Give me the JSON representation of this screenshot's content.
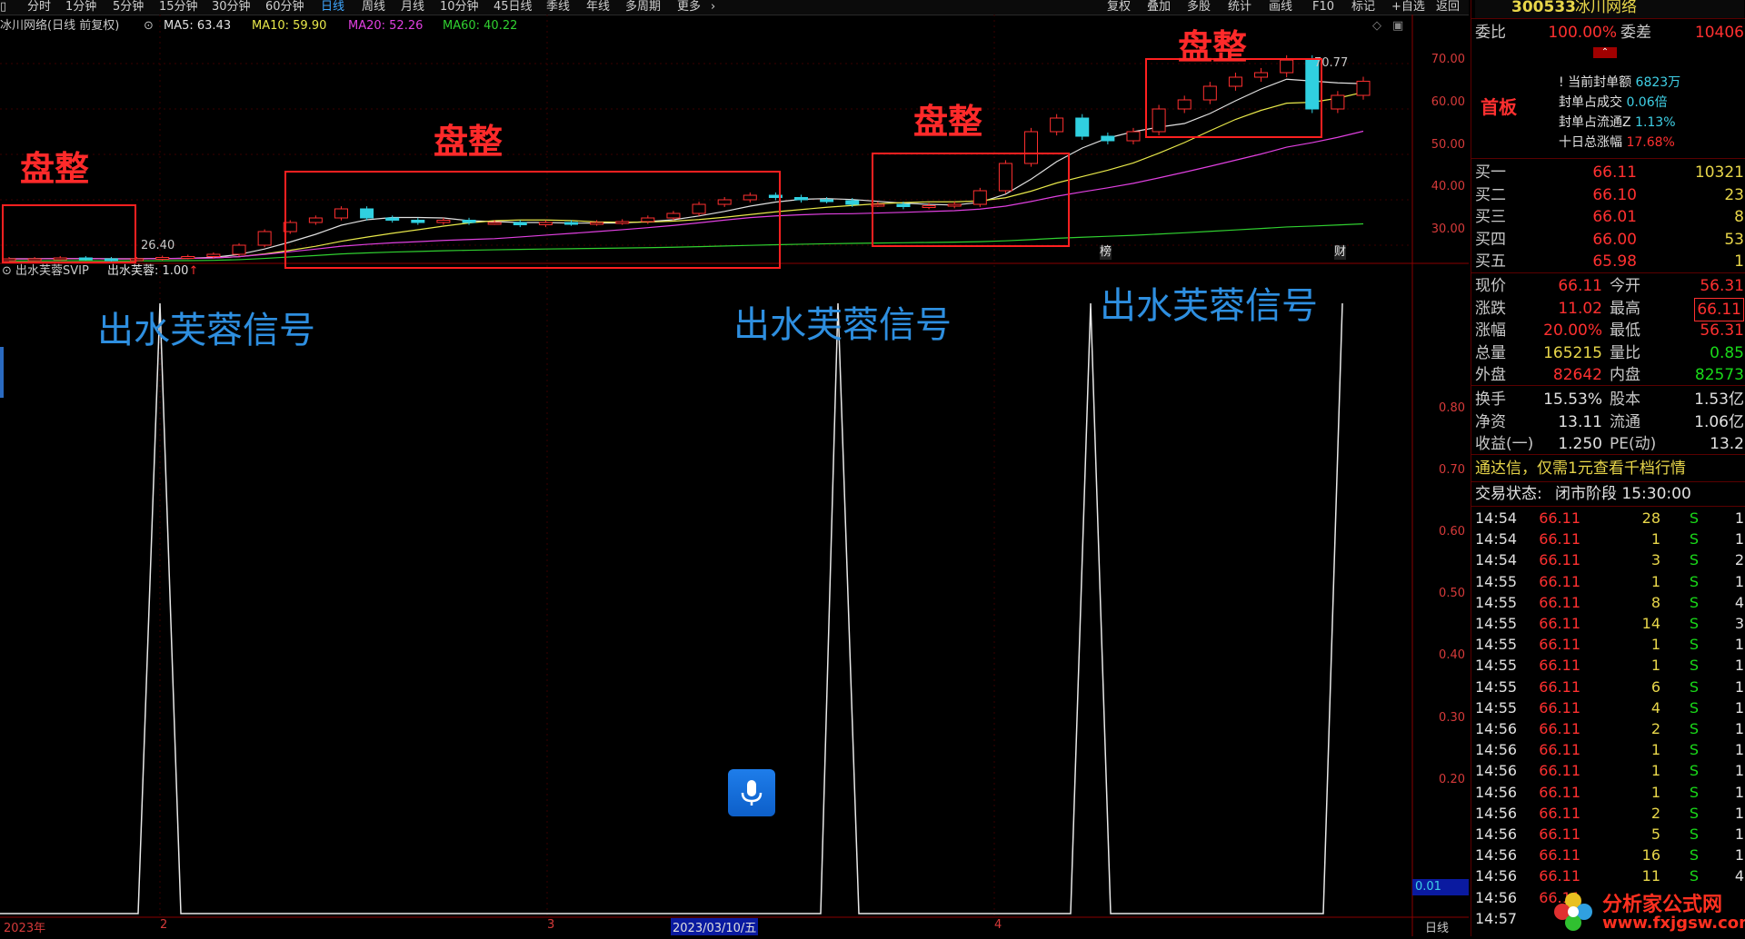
{
  "toolbar": {
    "tabs": [
      "分时",
      "1分钟",
      "5分钟",
      "15分钟",
      "30分钟",
      "60分钟",
      "日线",
      "周线",
      "月线",
      "10分钟",
      "45日线",
      "季线",
      "年线",
      "多周期",
      "更多"
    ],
    "active_tab": "日线",
    "more_chevron": "›",
    "right": [
      "复权",
      "叠加",
      "多股",
      "统计",
      "画线",
      "F10",
      "标记",
      "+自选",
      "返回"
    ]
  },
  "legend": {
    "title": "冰川网络(日线 前复权)",
    "ma5": "MA5: 63.43",
    "ma10": "MA10: 59.90",
    "ma20": "MA20: 52.26",
    "ma60": "MA60: 40.22",
    "colors": {
      "ma5": "#e0e0e0",
      "ma10": "#e8e84a",
      "ma20": "#e040e0",
      "ma60": "#30d030"
    }
  },
  "indicator_legend": {
    "name": "出水芙蓉SVIP",
    "value": "出水芙蓉: 1.00"
  },
  "price_axis": [
    "70.00",
    "60.00",
    "50.00",
    "40.00",
    "30.00"
  ],
  "indicator_axis": [
    "0.80",
    "0.70",
    "0.60",
    "0.50",
    "0.40",
    "0.30",
    "0.20"
  ],
  "indicator_bottom": "0.01",
  "high_label": "70.77",
  "low_label": "26.40",
  "markers": {
    "bang": "榜",
    "cai": "财"
  },
  "x_axis": {
    "year": "2023年",
    "m2": "2",
    "m3": "3",
    "m4": "4",
    "cursor_date": "2023/03/10/五",
    "period": "日线"
  },
  "annotations": {
    "consolidation": [
      "盘整",
      "盘整",
      "盘整",
      "盘整"
    ],
    "signal": [
      "出水芙蓉信号",
      "出水芙蓉信号",
      "出水芙蓉信号"
    ]
  },
  "chart_data": {
    "type": "line",
    "title": "",
    "series": [
      {
        "name": "出水芙蓉",
        "signals": [
          1,
          1,
          1
        ],
        "baseline": 0
      }
    ],
    "price_candles_approx": [
      27,
      27,
      27.2,
      27,
      26.8,
      27,
      27.3,
      27.5,
      28,
      30,
      33,
      35,
      36,
      38,
      36,
      35.5,
      35,
      35.5,
      35,
      35,
      34.5,
      35,
      34.8,
      35,
      35.2,
      36,
      37,
      39,
      40,
      41,
      40.5,
      40,
      39.8,
      39,
      39,
      38.5,
      38.7,
      39,
      42,
      48,
      55,
      58,
      54,
      53,
      55,
      60,
      62,
      65,
      67,
      68,
      70.77,
      60,
      63,
      66.11
    ],
    "ylim_price": [
      26,
      72
    ],
    "ylim_indicator": [
      0,
      1
    ]
  },
  "right_panel": {
    "code": "300533",
    "name": "冰川网络",
    "weibi_label": "委比",
    "weibi_value": "100.00%",
    "weicha_label": "委差",
    "weicha_value": "10406",
    "board_label": "首板",
    "seal": [
      {
        "label": "当前封单额",
        "value": "6823万"
      },
      {
        "label": "封单占成交",
        "value": "0.06倍"
      },
      {
        "label": "封单占流通Z",
        "value": "1.13%"
      },
      {
        "label": "十日总涨幅",
        "value": "17.68%"
      }
    ],
    "bids": [
      {
        "label": "买一",
        "price": "66.11",
        "vol": "10321"
      },
      {
        "label": "买二",
        "price": "66.10",
        "vol": "23"
      },
      {
        "label": "买三",
        "price": "66.01",
        "vol": "8"
      },
      {
        "label": "买四",
        "price": "66.00",
        "vol": "53"
      },
      {
        "label": "买五",
        "price": "65.98",
        "vol": "1"
      }
    ],
    "quote": [
      {
        "l1": "现价",
        "v1": "66.11",
        "l2": "今开",
        "v2": "56.31"
      },
      {
        "l1": "涨跌",
        "v1": "11.02",
        "l2": "最高",
        "v2": "66.11"
      },
      {
        "l1": "涨幅",
        "v1": "20.00%",
        "l2": "最低",
        "v2": "56.31"
      },
      {
        "l1": "总量",
        "v1": "165215",
        "l2": "量比",
        "v2": "0.85"
      },
      {
        "l1": "外盘",
        "v1": "82642",
        "l2": "内盘",
        "v2": "82573"
      }
    ],
    "fin": [
      {
        "l1": "换手",
        "v1": "15.53%",
        "l2": "股本",
        "v2": "1.53亿"
      },
      {
        "l1": "净资",
        "v1": "13.11",
        "l2": "流通",
        "v2": "1.06亿"
      },
      {
        "l1": "收益(一)",
        "v1": "1.250",
        "l2": "PE(动)",
        "v2": "13.2"
      }
    ],
    "promo": "通达信，仅需1元查看千档行情",
    "status_label": "交易状态:",
    "status_value": "闭市阶段 15:30:00",
    "ticks": [
      {
        "t": "14:54",
        "p": "66.11",
        "v": "28",
        "s": "S",
        "n": "1"
      },
      {
        "t": "14:54",
        "p": "66.11",
        "v": "1",
        "s": "S",
        "n": "1"
      },
      {
        "t": "14:54",
        "p": "66.11",
        "v": "3",
        "s": "S",
        "n": "2"
      },
      {
        "t": "14:55",
        "p": "66.11",
        "v": "1",
        "s": "S",
        "n": "1"
      },
      {
        "t": "14:55",
        "p": "66.11",
        "v": "8",
        "s": "S",
        "n": "4"
      },
      {
        "t": "14:55",
        "p": "66.11",
        "v": "14",
        "s": "S",
        "n": "3"
      },
      {
        "t": "14:55",
        "p": "66.11",
        "v": "1",
        "s": "S",
        "n": "1"
      },
      {
        "t": "14:55",
        "p": "66.11",
        "v": "1",
        "s": "S",
        "n": "1"
      },
      {
        "t": "14:55",
        "p": "66.11",
        "v": "6",
        "s": "S",
        "n": "1"
      },
      {
        "t": "14:55",
        "p": "66.11",
        "v": "4",
        "s": "S",
        "n": "1"
      },
      {
        "t": "14:56",
        "p": "66.11",
        "v": "2",
        "s": "S",
        "n": "1"
      },
      {
        "t": "14:56",
        "p": "66.11",
        "v": "1",
        "s": "S",
        "n": "1"
      },
      {
        "t": "14:56",
        "p": "66.11",
        "v": "1",
        "s": "S",
        "n": "1"
      },
      {
        "t": "14:56",
        "p": "66.11",
        "v": "1",
        "s": "S",
        "n": "1"
      },
      {
        "t": "14:56",
        "p": "66.11",
        "v": "2",
        "s": "S",
        "n": "1"
      },
      {
        "t": "14:56",
        "p": "66.11",
        "v": "5",
        "s": "S",
        "n": "1"
      },
      {
        "t": "14:56",
        "p": "66.11",
        "v": "16",
        "s": "S",
        "n": "1"
      },
      {
        "t": "14:56",
        "p": "66.11",
        "v": "11",
        "s": "S",
        "n": "4"
      },
      {
        "t": "14:56",
        "p": "66.11",
        "v": "",
        "s": "",
        "n": ""
      },
      {
        "t": "14:57",
        "p": "",
        "v": "",
        "s": "",
        "n": ""
      }
    ]
  },
  "watermark": {
    "name": "分析家公式网",
    "url": "www.fxjgsw.com"
  }
}
